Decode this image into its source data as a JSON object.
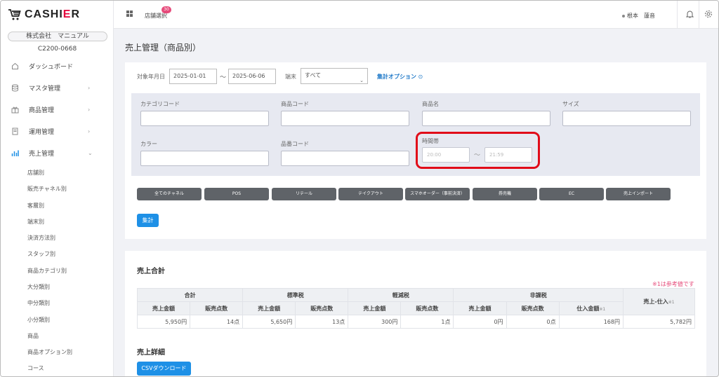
{
  "app": {
    "logo_prefix": "CASHI",
    "logo_highlight": "E",
    "logo_suffix": "R"
  },
  "sidebar": {
    "company": "株式会社　マニュアル",
    "code": "C2200-0668",
    "items": [
      {
        "label": "ダッシュボード",
        "icon": "home-icon"
      },
      {
        "label": "マスタ管理",
        "icon": "database-icon"
      },
      {
        "label": "商品管理",
        "icon": "gift-icon"
      },
      {
        "label": "運用管理",
        "icon": "document-icon"
      },
      {
        "label": "売上管理",
        "icon": "bar-chart-icon"
      }
    ],
    "sub_items": [
      "店舗別",
      "販売チャネル別",
      "客層別",
      "端末別",
      "決済方法別",
      "スタッフ別",
      "商品カテゴリ別",
      "大分類別",
      "中分類別",
      "小分類別",
      "商品",
      "商品オプション別",
      "コース"
    ]
  },
  "topbar": {
    "store_label": "店舗選択",
    "store_badge": "30",
    "user": "根本　蓮音"
  },
  "page": {
    "title": "売上管理（商品別）"
  },
  "filter": {
    "date_label": "対象年月日",
    "date_from": "2025-01-01",
    "date_sep": "〜",
    "date_to": "2025-06-06",
    "terminal_label": "端末",
    "terminal_value": "すべて",
    "options_link": "集計オプション"
  },
  "detail_filter": {
    "category_code": "カテゴリコード",
    "product_code": "商品コード",
    "product_name": "商品名",
    "size": "サイズ",
    "color": "カラー",
    "item_code": "品番コード",
    "time_band": "時間帯",
    "time_from_placeholder": "20:00",
    "time_sep": "〜",
    "time_to_placeholder": "21:59"
  },
  "channels": [
    "全てのチャネル",
    "POS",
    "リテール",
    "テイクアウト",
    "スマホオーダー（事前決済）",
    "券売機",
    "EC",
    "売上インポート"
  ],
  "aggregate_button": "集計",
  "summary": {
    "title": "売上合計",
    "note": "※1は参考値です",
    "groups": [
      "合計",
      "標準税",
      "軽減税",
      "非課税"
    ],
    "col_amount": "売上金額",
    "col_qty": "販売点数",
    "col_purchase": "仕入金額",
    "col_profit": "売上-仕入",
    "mark": "※1",
    "row": [
      "5,950円",
      "14点",
      "5,650円",
      "13点",
      "300円",
      "1点",
      "0円",
      "0点",
      "168円",
      "5,782円"
    ]
  },
  "detail": {
    "title": "売上詳細",
    "csv_button": "CSVダウンロード"
  }
}
